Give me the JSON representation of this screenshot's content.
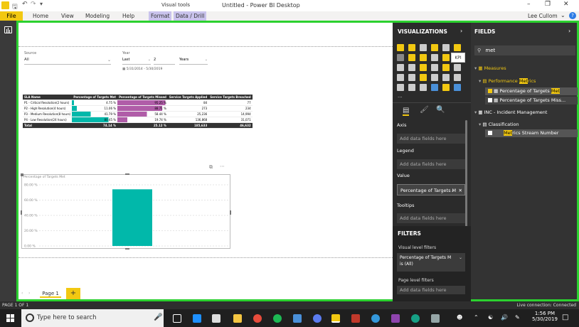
{
  "title": {
    "text": "Untitled - Power BI Desktop",
    "context_group": "Visual tools"
  },
  "ribbon": {
    "file": "File",
    "tabs": [
      "Home",
      "View",
      "Modeling",
      "Help",
      "Format",
      "Data / Drill"
    ],
    "user": "Lee Cullom"
  },
  "report": {
    "slicer_source": {
      "label": "Source",
      "value": "All"
    },
    "slicer_year": {
      "label": "Year",
      "mode": "Last",
      "count": "2",
      "unit": "Years",
      "range": "5/31/2014 - 5/30/2019"
    },
    "table": {
      "headers": [
        "SLA Name",
        "Percentage of Targets Met",
        "Percentage of Targets Missed",
        "Service Targets Applied",
        "Service Targets Breached"
      ],
      "rows": [
        [
          "P1 - Critical Resolution(2 hours)",
          "4.75 %",
          "95.25 %",
          "84",
          "77"
        ],
        [
          "P2 - High Resolution(4 hours)",
          "11.06 %",
          "88.71 %",
          "273",
          "234"
        ],
        [
          "P3 - Medium Resolution(8 hours)",
          "41.79 %",
          "58.44 %",
          "25,236",
          "14,994"
        ],
        [
          "P4 - Low Resolution(24 hours)",
          "80.45 %",
          "19.74 %",
          "136,868",
          "31,071"
        ]
      ],
      "total": [
        "Total",
        "74.14 %",
        "25.12 %",
        "185,633",
        "46,632"
      ],
      "met_fraction": [
        0.0475,
        0.1106,
        0.4179,
        0.8045
      ],
      "missed_fraction": [
        0.9525,
        0.8871,
        0.5844,
        0.1974
      ]
    },
    "page_tab": "Page 1",
    "add_page": "+"
  },
  "chart_data": {
    "type": "bar",
    "title": "Percentage of Targets Met",
    "categories": [
      ""
    ],
    "values": [
      74.14
    ],
    "ylim": [
      0,
      80
    ],
    "yticks": [
      "80.00 %",
      "60.00 %",
      "40.00 %",
      "20.00 %",
      "0.00 %"
    ],
    "grid": true,
    "color": "#01b8aa"
  },
  "visualizations": {
    "header": "VISUALIZATIONS",
    "tooltip": "KPI",
    "more": "...",
    "sections": {
      "axis": "Axis",
      "legend": "Legend",
      "value": "Value",
      "tooltips": "Tooltips",
      "placeholder": "Add data fields here",
      "value_field": "Percentage of Targets M"
    },
    "filters": {
      "header": "FILTERS",
      "visual_level": "Visual level filters",
      "filter_item_line1": "Percentage of Targets M",
      "filter_item_line2": "is (All)",
      "page_level": "Page level filters",
      "placeholder": "Add data fields here"
    }
  },
  "fields": {
    "header": "FIELDS",
    "search_value": "met",
    "tree": {
      "measures": "Measures",
      "perf_prefix": "Performance ",
      "perf_hl": "Met",
      "perf_suffix": "rics",
      "item1_prefix": "Percentage of Targets ",
      "item1_hl": "Met",
      "item2": "Percentage of Targets Miss...",
      "inc": "INC - Incident Management",
      "classification": "Classification",
      "item3_hl": "Met",
      "item3_suffix": "rics Stream Number"
    }
  },
  "status": {
    "page": "PAGE 1 OF 1",
    "connection": "Live connection: Connected"
  },
  "taskbar": {
    "search_placeholder": "Type here to search",
    "time": "1:56 PM",
    "date": "5/30/2019"
  }
}
